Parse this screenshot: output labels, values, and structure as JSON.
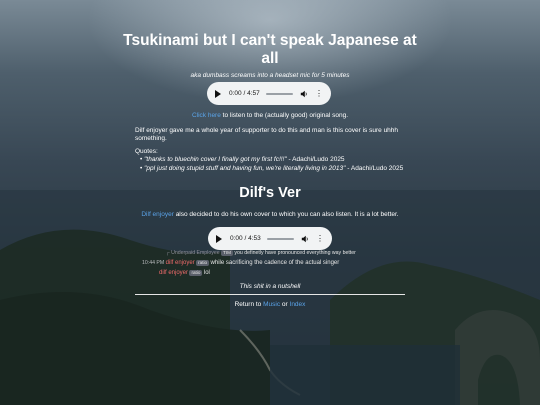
{
  "page": {
    "title": "Tsukinami but I can't speak Japanese at all",
    "subtitle": "aka dumbass screams into a headset mic for 5 minutes"
  },
  "audio1": {
    "time": "0:00 / 4:57"
  },
  "original": {
    "link_text": "Click here",
    "rest_text": "to listen to the (actually good) original song."
  },
  "intro_text": "Dilf enjoyer gave me a whole year of supporter to do this and man is this cover is sure uhhh something.",
  "quotes": {
    "label": "Quotes:",
    "items": [
      {
        "quote": "\"thanks to bluechin cover I finally got my first fc!!!\"",
        "author": " - Adachi/Ludo 2025"
      },
      {
        "quote": "\"ppl just doing stupid stuff and having fun, we're literally living in 2013\"",
        "author": " - Adachi/Ludo 2025"
      }
    ]
  },
  "section2": {
    "heading": "Dilf's Ver",
    "link_text": "Dilf enjoyer",
    "rest_text": "also decided to do his own cover to which you can also listen. It is a lot better."
  },
  "audio2": {
    "time": "0:00 / 4:53"
  },
  "discord": {
    "reply_name": "Underpaid Employee",
    "reply_tag": "TIM",
    "reply_text": "you definetly have pronounced everything way better",
    "time": "10:44 PM",
    "user": "dilf enjoyer",
    "user_tag": "ratio",
    "msg1": "while sacrificing the cadence of the actual singer",
    "msg2": "lol"
  },
  "caption": "This shit in a nutshell",
  "footer": {
    "prefix": "Return to",
    "music": "Music",
    "or": "or",
    "index": "Index"
  },
  "colors": {
    "link": "#5aa3e8",
    "discord_name": "#ee6a6a",
    "player_bg": "#f1f3f4"
  }
}
